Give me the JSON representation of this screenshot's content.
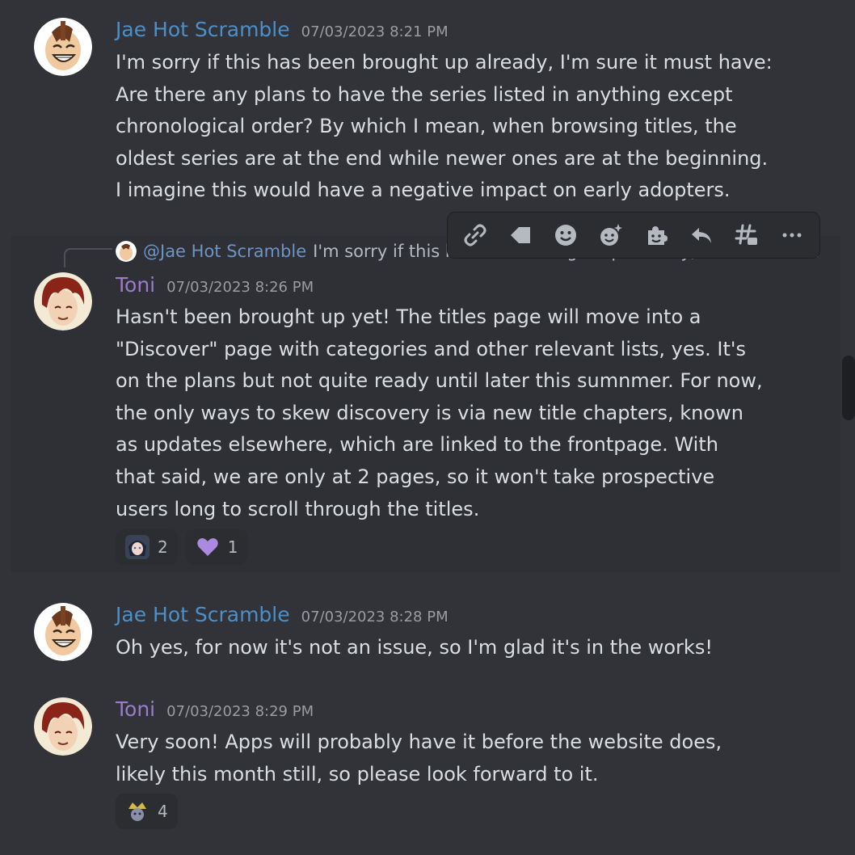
{
  "messages": [
    {
      "author": "Jae Hot Scramble",
      "timestamp": "07/03/2023 8:21 PM",
      "text": "I'm sorry if this has been brought up already, I'm sure it must have:\nAre there any plans to have the series listed in anything except\nchronological order? By which I mean, when browsing titles, the\noldest series are at the end while newer ones are at the beginning.\nI imagine this would have a negative impact on early adopters."
    },
    {
      "author": "Toni",
      "timestamp": "07/03/2023 8:26 PM",
      "reply_to": {
        "mention": "@Jae Hot Scramble",
        "preview": "I'm sorry if this has been brought up already, I'm sure it must have:"
      },
      "text": "Hasn't been brought up yet! The titles page will move into a\n\"Discover\" page with categories and other relevant lists, yes. It's\non the plans but not quite ready until later this sumnmer. For now,\nthe only ways to skew discovery is via new title chapters, known\nas updates elsewhere, which are linked to the frontpage. With\nthat said, we are only at 2 pages, so it won't take prospective\nusers long to scroll through the titles.",
      "reactions": [
        {
          "emoji": "custom-character-emoji",
          "count": "2"
        },
        {
          "emoji": "purple-heart",
          "count": "1"
        }
      ]
    },
    {
      "author": "Jae Hot Scramble",
      "timestamp": "07/03/2023 8:28 PM",
      "text": "Oh yes, for now it's not an issue, so I'm glad it's in the works!"
    },
    {
      "author": "Toni",
      "timestamp": "07/03/2023 8:29 PM",
      "text": "Very soon! Apps will probably have it before the website does,\nlikely this month still, so please look forward to it.",
      "reactions": [
        {
          "emoji": "custom-crown-emoji",
          "count": "4"
        }
      ]
    }
  ],
  "toolbar": {
    "actions": [
      "copy-link",
      "mark-unread",
      "add-reaction",
      "super-reaction",
      "app-reaction",
      "reply",
      "create-thread",
      "more"
    ]
  },
  "colors": {
    "background": "#313338",
    "jae_name": "#4d8fc9",
    "toni_name": "#9b7cc8",
    "heart": "#a98ae0"
  }
}
